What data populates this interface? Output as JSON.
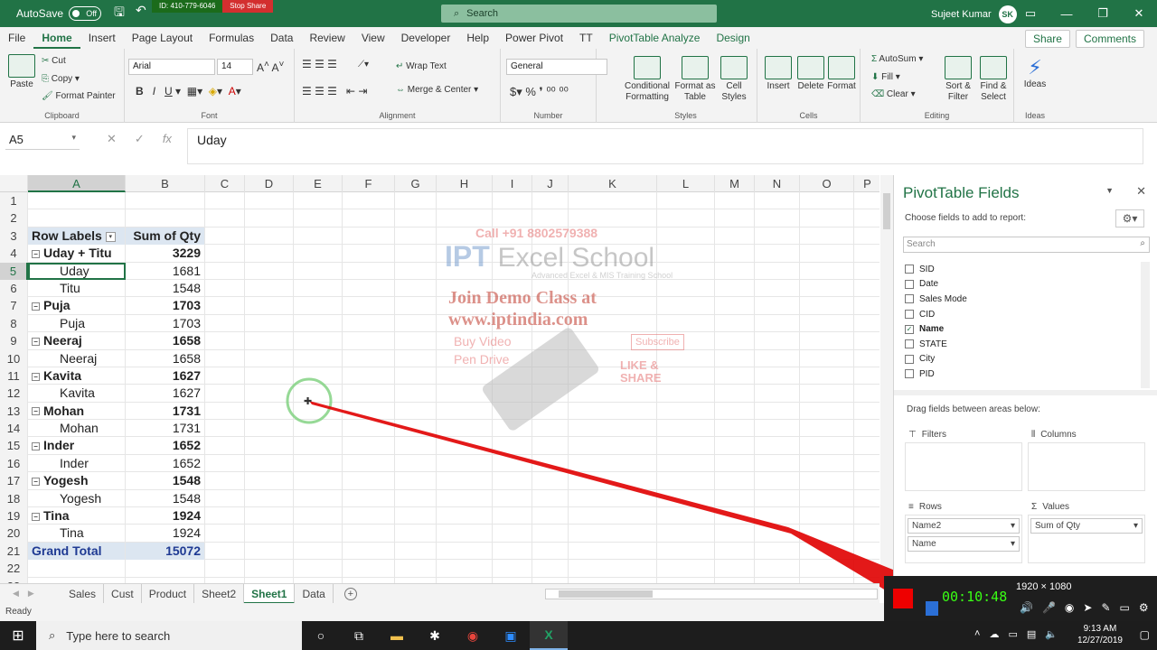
{
  "titlebar": {
    "autosave_label": "AutoSave",
    "autosave_state": "Off",
    "share_id": "ID: 410-779-6046",
    "stop_share": "Stop Share",
    "search_placeholder": "Search",
    "user_name": "Sujeet Kumar",
    "user_initials": "SK"
  },
  "tabs": [
    "File",
    "Home",
    "Insert",
    "Page Layout",
    "Formulas",
    "Data",
    "Review",
    "View",
    "Developer",
    "Help",
    "Power Pivot",
    "TT",
    "PivotTable Analyze",
    "Design"
  ],
  "ribbon_actions": {
    "share": "Share",
    "comments": "Comments"
  },
  "ribbon": {
    "clipboard": {
      "label": "Clipboard",
      "paste": "Paste",
      "cut": "Cut",
      "copy": "Copy",
      "format_painter": "Format Painter"
    },
    "font": {
      "label": "Font",
      "name": "Arial",
      "size": "14"
    },
    "alignment": {
      "label": "Alignment",
      "wrap": "Wrap Text",
      "merge": "Merge & Center"
    },
    "number": {
      "label": "Number",
      "format": "General"
    },
    "styles": {
      "label": "Styles",
      "cond": "Conditional Formatting",
      "table": "Format as Table",
      "cell": "Cell Styles"
    },
    "cells": {
      "label": "Cells",
      "insert": "Insert",
      "delete": "Delete",
      "format": "Format"
    },
    "editing": {
      "label": "Editing",
      "autosum": "AutoSum",
      "fill": "Fill",
      "clear": "Clear",
      "sort": "Sort & Filter",
      "find": "Find & Select"
    },
    "ideas": {
      "label": "Ideas",
      "btn": "Ideas"
    }
  },
  "formula_bar": {
    "name_box": "A5",
    "value": "Uday"
  },
  "columns": [
    "A",
    "B",
    "C",
    "D",
    "E",
    "F",
    "G",
    "H",
    "I",
    "J",
    "K",
    "L",
    "M",
    "N",
    "O",
    "P"
  ],
  "pivot_header": {
    "row_labels": "Row Labels",
    "sum_label": "Sum of Qty"
  },
  "rows": [
    {
      "n": "1",
      "a": "",
      "b": "",
      "kind": "empty"
    },
    {
      "n": "2",
      "a": "",
      "b": "",
      "kind": "empty"
    },
    {
      "n": "3",
      "a": "Row Labels",
      "b": "Sum of Qty",
      "kind": "header"
    },
    {
      "n": "4",
      "a": "Uday + Titu",
      "b": "3229",
      "kind": "group"
    },
    {
      "n": "5",
      "a": "Uday",
      "b": "1681",
      "kind": "child"
    },
    {
      "n": "6",
      "a": "Titu",
      "b": "1548",
      "kind": "child"
    },
    {
      "n": "7",
      "a": "Puja",
      "b": "1703",
      "kind": "group"
    },
    {
      "n": "8",
      "a": "Puja",
      "b": "1703",
      "kind": "child"
    },
    {
      "n": "9",
      "a": "Neeraj",
      "b": "1658",
      "kind": "group"
    },
    {
      "n": "10",
      "a": "Neeraj",
      "b": "1658",
      "kind": "child"
    },
    {
      "n": "11",
      "a": "Kavita",
      "b": "1627",
      "kind": "group"
    },
    {
      "n": "12",
      "a": "Kavita",
      "b": "1627",
      "kind": "child"
    },
    {
      "n": "13",
      "a": "Mohan",
      "b": "1731",
      "kind": "group"
    },
    {
      "n": "14",
      "a": "Mohan",
      "b": "1731",
      "kind": "child"
    },
    {
      "n": "15",
      "a": "Inder",
      "b": "1652",
      "kind": "group"
    },
    {
      "n": "16",
      "a": "Inder",
      "b": "1652",
      "kind": "child"
    },
    {
      "n": "17",
      "a": "Yogesh",
      "b": "1548",
      "kind": "group"
    },
    {
      "n": "18",
      "a": "Yogesh",
      "b": "1548",
      "kind": "child"
    },
    {
      "n": "19",
      "a": "Tina",
      "b": "1924",
      "kind": "group"
    },
    {
      "n": "20",
      "a": "Tina",
      "b": "1924",
      "kind": "child"
    },
    {
      "n": "21",
      "a": "Grand Total",
      "b": "15072",
      "kind": "total"
    },
    {
      "n": "22",
      "a": "",
      "b": "",
      "kind": "empty"
    },
    {
      "n": "23",
      "a": "",
      "b": "",
      "kind": "empty"
    }
  ],
  "watermark": {
    "call": "Call +91 8802579388",
    "brand_a": "IPT",
    "brand_b": "Excel School",
    "tagline": "Advanced Excel & MIS Training School",
    "join": "Join Demo Class at",
    "site": "www.iptindia.com",
    "buy": "Buy Video",
    "pen": "Pen Drive",
    "subscribe": "Subscribe",
    "like": "LIKE & SHARE"
  },
  "sheets": [
    "Sales",
    "Cust",
    "Product",
    "Sheet2",
    "Sheet1",
    "Data"
  ],
  "active_sheet": "Sheet1",
  "status": "Ready",
  "pivot_panel": {
    "title": "PivotTable Fields",
    "subtitle": "Choose fields to add to report:",
    "search_placeholder": "Search",
    "fields": [
      {
        "name": "SID",
        "checked": false
      },
      {
        "name": "Date",
        "checked": false
      },
      {
        "name": "Sales Mode",
        "checked": false
      },
      {
        "name": "CID",
        "checked": false
      },
      {
        "name": "Name",
        "checked": true
      },
      {
        "name": "STATE",
        "checked": false
      },
      {
        "name": "City",
        "checked": false
      },
      {
        "name": "PID",
        "checked": false
      }
    ],
    "drag_label": "Drag fields between areas below:",
    "filters": "Filters",
    "columns": "Columns",
    "rows": "Rows",
    "values": "Values",
    "rows_items": [
      "Name2",
      "Name"
    ],
    "values_items": [
      "Sum of Qty"
    ]
  },
  "recorder": {
    "time": "00:10:48",
    "resolution": "1920 × 1080"
  },
  "taskbar": {
    "search": "Type here to search",
    "time": "9:13 AM",
    "date": "12/27/2019"
  },
  "colors": {
    "excel_green": "#217346",
    "pivot_header_fill": "#dce6f1",
    "laser": "#e00000"
  }
}
